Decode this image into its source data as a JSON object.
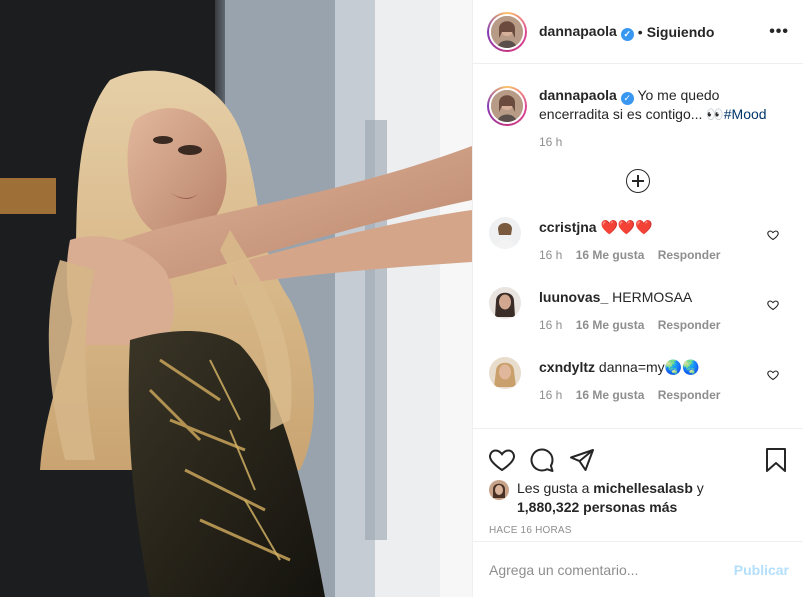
{
  "header": {
    "username": "dannapaola",
    "verified_icon": "verified-badge-icon",
    "separator": "•",
    "follow_status": "Siguiendo",
    "more_icon": "•••"
  },
  "caption": {
    "username": "dannapaola",
    "text": "Yo me quedo encerradita si es contigo... 👀",
    "hashtag": "#Mood",
    "time": "16 h"
  },
  "load_more_icon": "plus-circle-icon",
  "comments": [
    {
      "username": "ccristjna",
      "text": "❤️❤️❤️",
      "time": "16 h",
      "likes": "16 Me gusta",
      "reply": "Responder"
    },
    {
      "username": "luunovas_",
      "text": "HERMOSAA",
      "time": "16 h",
      "likes": "16 Me gusta",
      "reply": "Responder"
    },
    {
      "username": "cxndyltz",
      "text": "danna=my🌏🌏",
      "time": "16 h",
      "likes": "16 Me gusta",
      "reply": "Responder"
    }
  ],
  "likes": {
    "prefix": "Les gusta a",
    "user": "michellesalasb",
    "connector": "y",
    "count": "1,880,322 personas más"
  },
  "posted_ago": "HACE 16 HORAS",
  "comment_input": {
    "placeholder": "Agrega un comentario...",
    "value": "",
    "submit_label": "Publicar"
  },
  "colors": {
    "text": "#262626",
    "secondary": "#8e8e8e",
    "verified": "#3897f0",
    "hashtag": "#00376b",
    "publish_disabled": "#b2dffc",
    "border": "#efefef"
  }
}
